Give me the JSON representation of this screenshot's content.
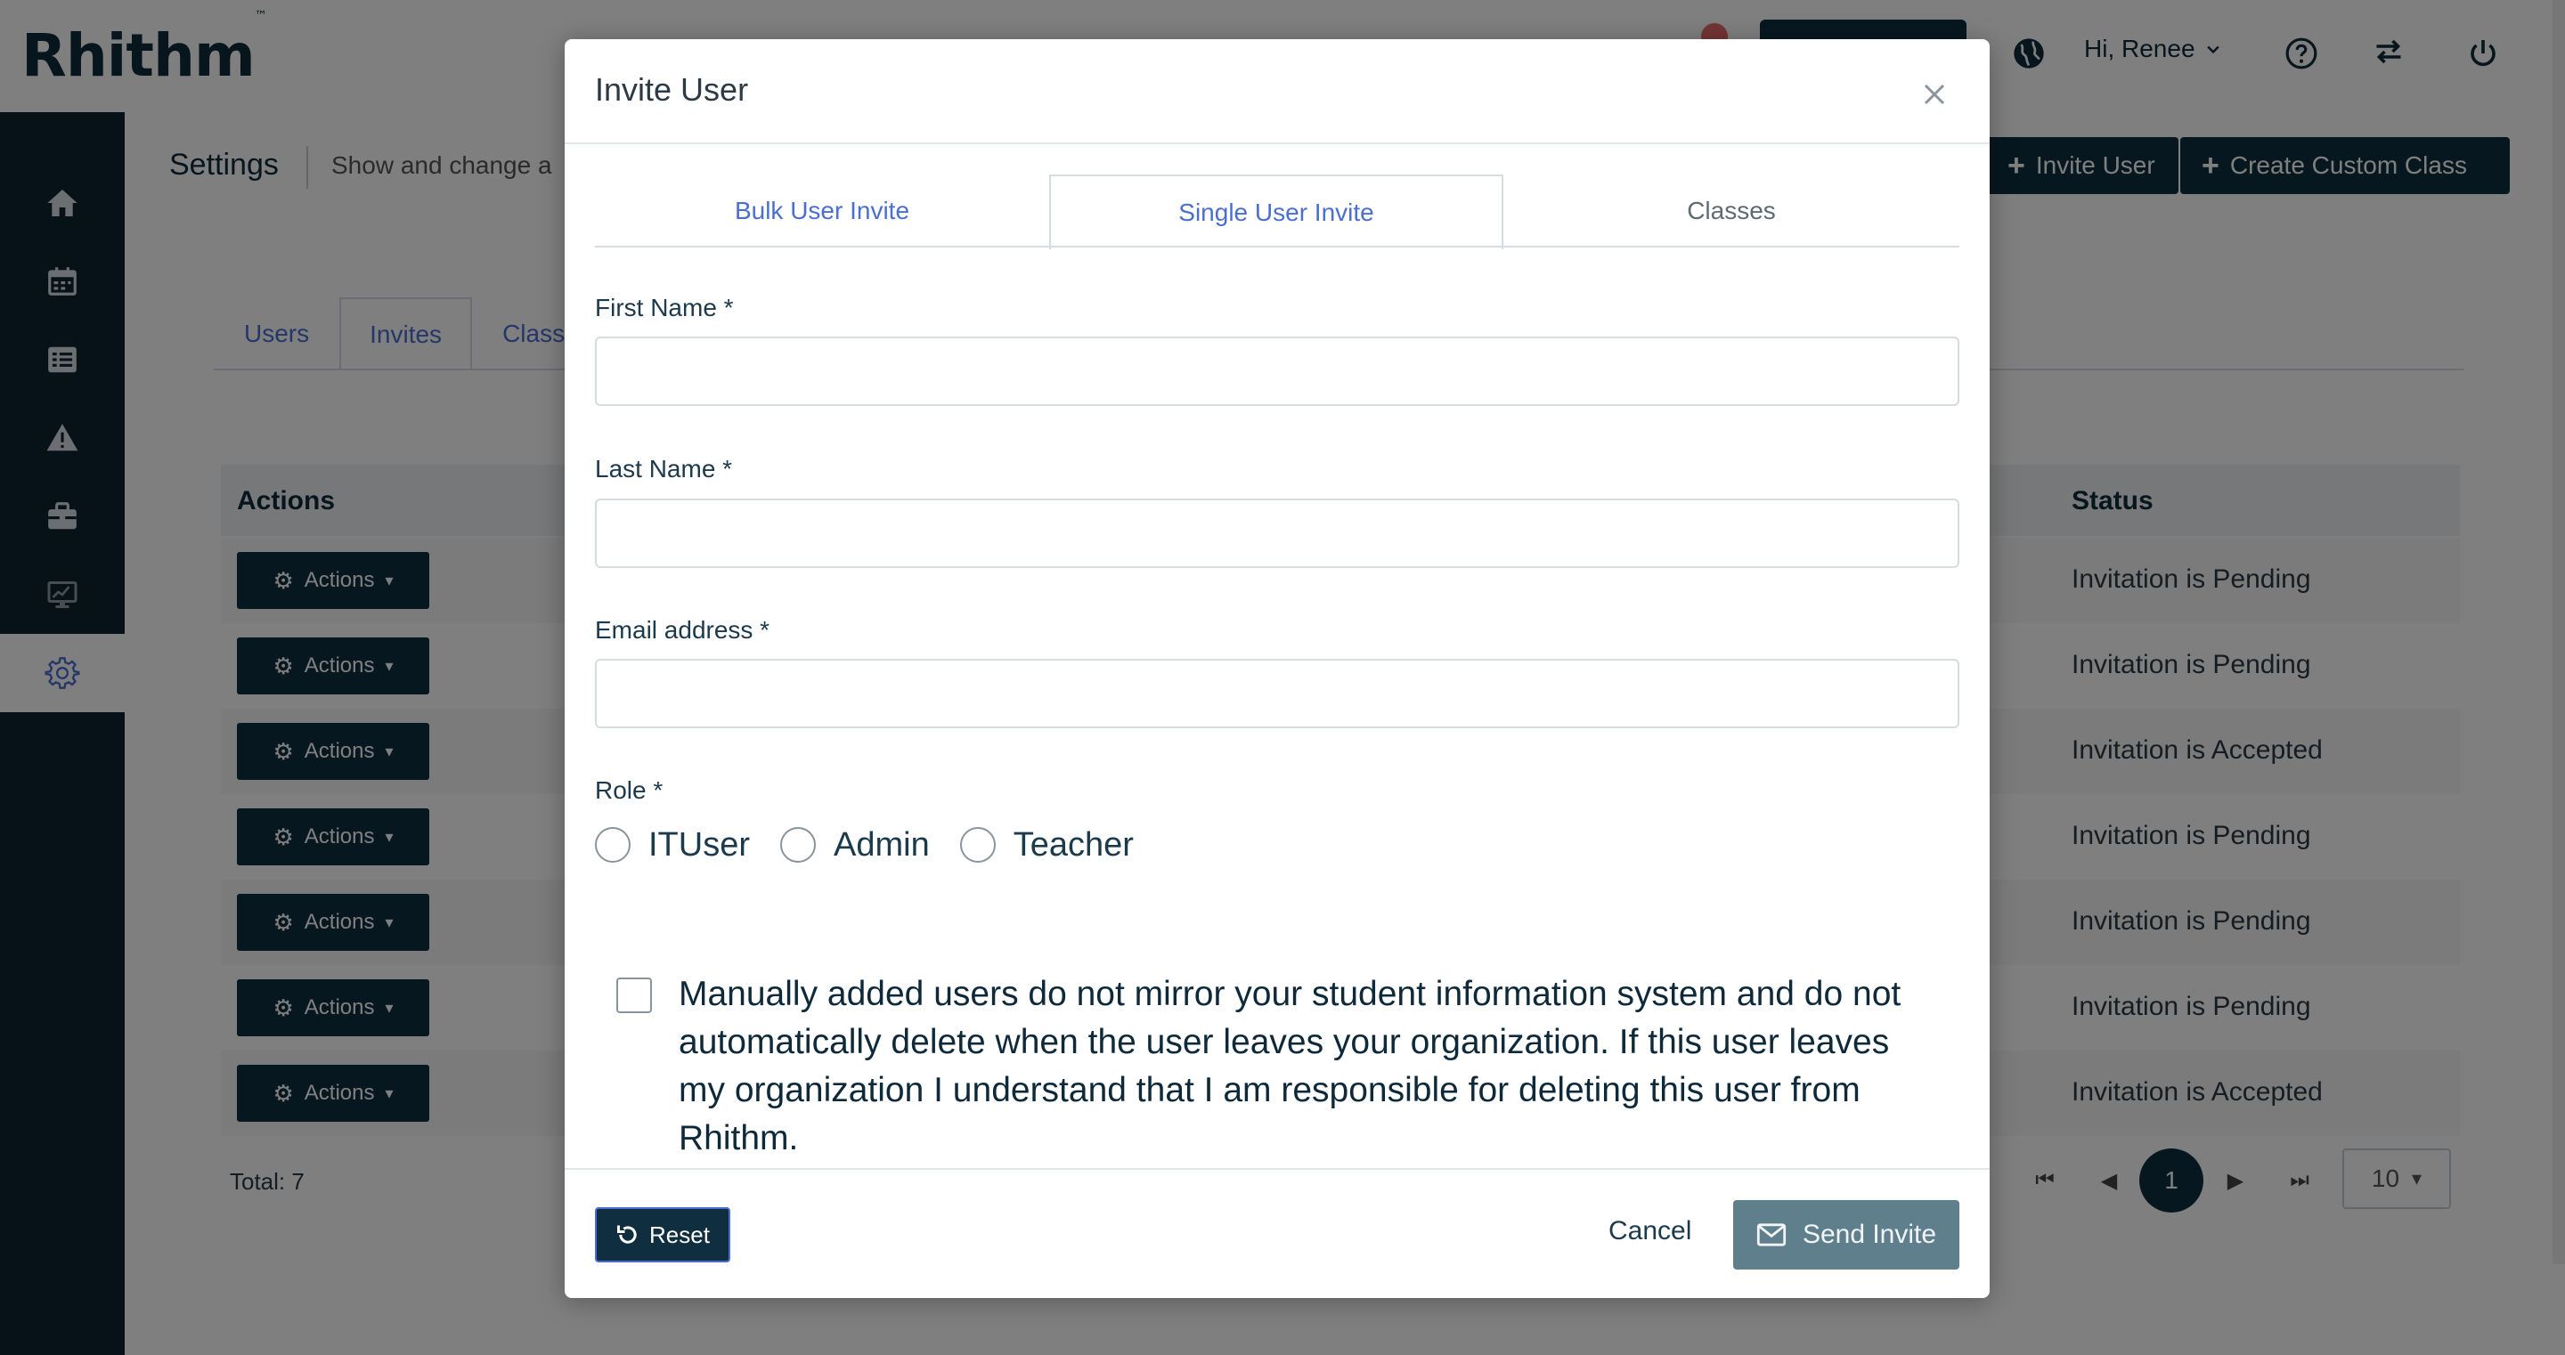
{
  "header": {
    "logo": "Rhithm",
    "logo_mark": "™",
    "greeting": "Hi, Renee"
  },
  "page": {
    "title": "Settings",
    "subtitle": "Show and change a",
    "invite_user_btn": "Invite User",
    "create_class_btn": "Create Custom Class",
    "tabs": [
      "Users",
      "Invites",
      "Class"
    ],
    "table": {
      "col_actions": "Actions",
      "col_status": "Status",
      "rows": [
        {
          "action": "Actions",
          "status": "Invitation is Pending"
        },
        {
          "action": "Actions",
          "status": "Invitation is Pending"
        },
        {
          "action": "Actions",
          "status": "Invitation is Accepted"
        },
        {
          "action": "Actions",
          "status": "Invitation is Pending"
        },
        {
          "action": "Actions",
          "status": "Invitation is Pending"
        },
        {
          "action": "Actions",
          "status": "Invitation is Pending"
        },
        {
          "action": "Actions",
          "status": "Invitation is Accepted"
        }
      ]
    },
    "total": "Total: 7",
    "pagination": {
      "current": "1",
      "page_size": "10"
    }
  },
  "modal": {
    "title": "Invite User",
    "tabs": [
      "Bulk User Invite",
      "Single User Invite",
      "Classes"
    ],
    "active_tab": "Single User Invite",
    "first_name_label": "First Name *",
    "first_name_value": "",
    "last_name_label": "Last Name *",
    "last_name_value": "",
    "email_label": "Email address *",
    "email_value": "",
    "role_label": "Role *",
    "roles": [
      "ITUser",
      "Admin",
      "Teacher"
    ],
    "acknowledgement": "Manually added users do not mirror your student information system and do not automatically delete when the user leaves your organization. If this user leaves my organization I understand that I am responsible for deleting this user from Rhithm.",
    "reset_btn": "Reset",
    "cancel_btn": "Cancel",
    "send_btn": "Send Invite"
  },
  "colors": {
    "navy": "#0f2f40",
    "sidebar": "#0c2431",
    "link_blue": "#4a6fd1",
    "send_btn": "#5f7f8d",
    "notify_dot": "#e86a6a"
  },
  "icons": {
    "sidebar": [
      "home-icon",
      "calendar-icon",
      "list-icon",
      "warning-icon",
      "briefcase-icon",
      "monitor-chart-icon",
      "gear-icon"
    ],
    "header": [
      "globe-icon",
      "help-icon",
      "switch-icon",
      "power-icon"
    ]
  }
}
